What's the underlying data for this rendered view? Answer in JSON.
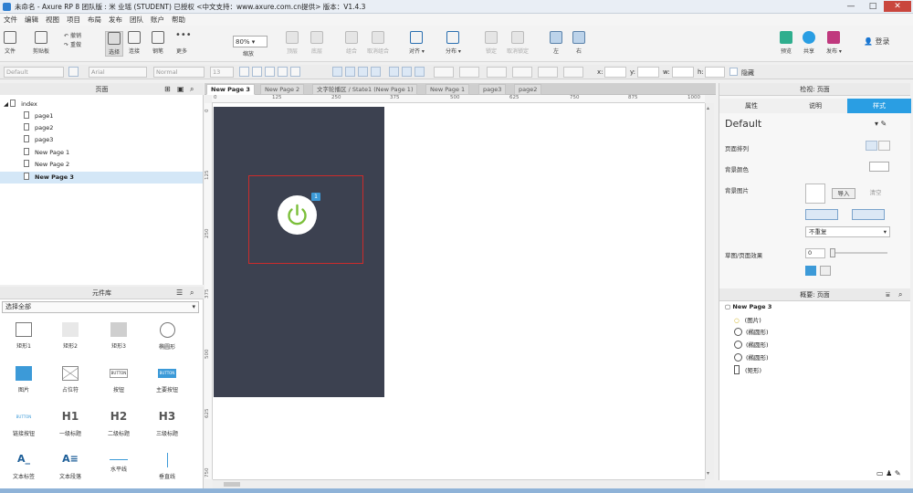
{
  "window": {
    "title": "未命名 - Axure RP 8 团队版 : 米 业瑶 (STUDENT) 已授权    <中文支持：www.axure.com.cn提供> 版本：V1.4.3",
    "minimize": "—",
    "maximize": "□",
    "close": "✕"
  },
  "menu": [
    "文件",
    "编辑",
    "视图",
    "项目",
    "布局",
    "发布",
    "团队",
    "账户",
    "帮助"
  ],
  "toolbar": {
    "file": "文件",
    "clipboard": "剪贴板",
    "undo": "撤销",
    "redo": "重做",
    "select": "选择",
    "connect": "连接",
    "pen": "钢笔",
    "more": "更多",
    "zoom_value": "80%",
    "zoom_label": "缩放",
    "top": "顶层",
    "bottom": "底层",
    "group": "组合",
    "ungroup": "取消组合",
    "align": "对齐",
    "distribute": "分布",
    "lock": "锁定",
    "unlock": "取消锁定",
    "left": "左",
    "right": "右",
    "preview": "预览",
    "share": "共享",
    "publish": "发布",
    "login": "登录"
  },
  "format_bar": {
    "style": "Default",
    "font": "Arial",
    "weight": "Normal",
    "size": "13",
    "x_label": "x:",
    "y_label": "y:",
    "w_label": "w:",
    "h_label": "h:",
    "hidden_label": "隐藏"
  },
  "pages_panel": {
    "title": "页面",
    "items": [
      {
        "label": "index",
        "level": 0
      },
      {
        "label": "page1",
        "level": 1
      },
      {
        "label": "page2",
        "level": 1
      },
      {
        "label": "page3",
        "level": 1
      },
      {
        "label": "New Page 1",
        "level": 1
      },
      {
        "label": "New Page 2",
        "level": 1
      },
      {
        "label": "New Page 3",
        "level": 1,
        "selected": true
      }
    ]
  },
  "library_panel": {
    "title": "元件库",
    "filter": "选择全部",
    "widgets": [
      {
        "label": "矩形1",
        "icon": "rect-icon"
      },
      {
        "label": "矩形2",
        "icon": "rect-gray-icon"
      },
      {
        "label": "矩形3",
        "icon": "rect-dark-icon"
      },
      {
        "label": "椭圆形",
        "icon": "ellipse-icon"
      },
      {
        "label": "图片",
        "icon": "image-icon"
      },
      {
        "label": "占位符",
        "icon": "placeholder-icon"
      },
      {
        "label": "按钮",
        "icon": "button-icon",
        "text": "BUTTON"
      },
      {
        "label": "主要按钮",
        "icon": "primary-button-icon",
        "text": "BUTTON"
      },
      {
        "label": "链接按钮",
        "icon": "link-button-icon",
        "text": "BUTTON"
      },
      {
        "label": "一级标题",
        "icon": "h1-icon",
        "text": "H1"
      },
      {
        "label": "二级标题",
        "icon": "h2-icon",
        "text": "H2"
      },
      {
        "label": "三级标题",
        "icon": "h3-icon",
        "text": "H3"
      },
      {
        "label": "文本标签",
        "icon": "text-label-icon",
        "text": "A_"
      },
      {
        "label": "文本段落",
        "icon": "text-paragraph-icon",
        "text": "A≡"
      },
      {
        "label": "水平线",
        "icon": "hline-icon"
      },
      {
        "label": "垂直线",
        "icon": "vline-icon"
      }
    ]
  },
  "tabs": [
    "New Page 3",
    "New Page 2",
    "文字轮播区 / State1 (New Page 1)",
    "New Page 1",
    "page3",
    "page2"
  ],
  "rulers": {
    "h": [
      "0",
      "125",
      "250",
      "375",
      "500",
      "625",
      "750",
      "875",
      "1000"
    ],
    "v": [
      "0",
      "125",
      "250",
      "375",
      "500",
      "625",
      "750"
    ]
  },
  "canvas": {
    "badge": "1"
  },
  "inspector": {
    "title": "检视: 页面",
    "tabs": [
      "属性",
      "说明",
      "样式"
    ],
    "style_name": "Default",
    "rows": {
      "arrange": "页面排列",
      "bg_color": "背景颜色",
      "bg_image": "背景图片",
      "import": "导入",
      "clear": "清空",
      "repeat": "不重复",
      "sketch": "草图/页面效果",
      "sketch_value": "0"
    }
  },
  "outline": {
    "title": "概要: 页面",
    "root": "New Page 3",
    "items": [
      "(图片)",
      "(椭圆形)",
      "(椭圆形)",
      "(椭圆形)",
      "(矩形)"
    ]
  },
  "colors": {
    "accent": "#2a9ee3",
    "dark_panel": "#3c4150",
    "power_green": "#7bbf3a",
    "selection": "#cc2b2b"
  }
}
